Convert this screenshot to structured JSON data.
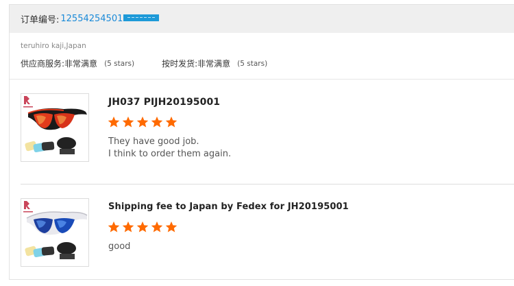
{
  "order": {
    "label": "订单编号:",
    "number": "12554254501"
  },
  "buyer": "teruhiro kaji,Japan",
  "ratings": [
    {
      "label": "供应商服务:",
      "value": "非常满意",
      "stars_text": "(5 stars)"
    },
    {
      "label": "按时发货:",
      "value": "非常满意",
      "stars_text": "(5 stars)"
    }
  ],
  "items": [
    {
      "title": "JH037 PIJH20195001",
      "rating": 5,
      "review_lines": [
        "They have good job.",
        "I think to order them again."
      ],
      "thumb_icon": "red-sport-sunglasses-product-image"
    },
    {
      "title": "Shipping fee to Japan by Fedex for JH20195001",
      "rating": 5,
      "review_lines": [
        "good"
      ],
      "thumb_icon": "white-blue-sport-sunglasses-product-image"
    }
  ],
  "colors": {
    "order_number": "#1a8ad8",
    "star": "#ff6a00",
    "header_bg": "#efefef"
  }
}
